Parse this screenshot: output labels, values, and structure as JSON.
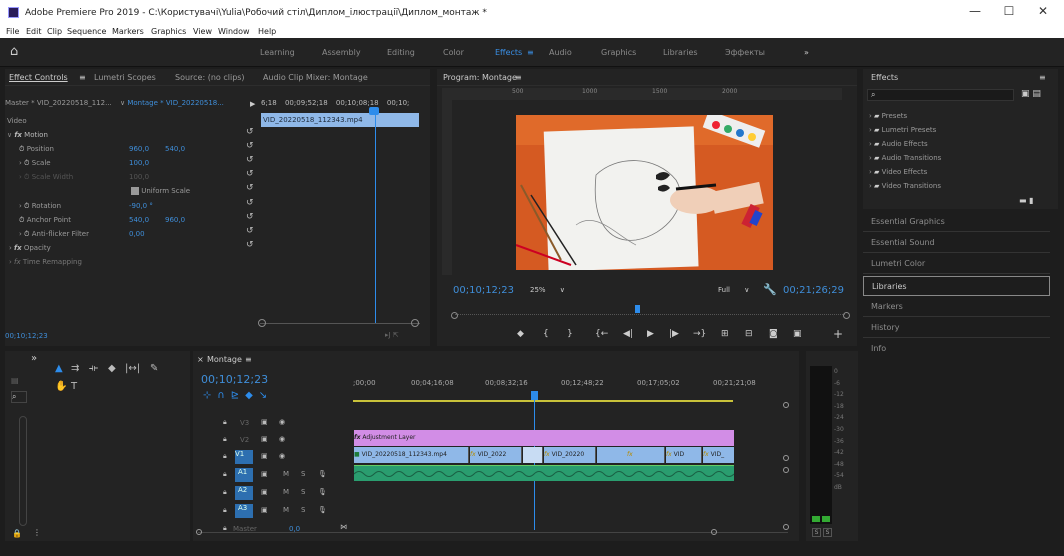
{
  "window": {
    "title": "Adobe Premiere Pro 2019 - C:\\Користувачі\\Yulia\\Робочий стіл\\Диплом_ілюстрації\\Диплом_монтаж *",
    "minimize": "—",
    "maximize": "☐",
    "close": "✕"
  },
  "menu": [
    "File",
    "Edit",
    "Clip",
    "Sequence",
    "Markers",
    "Graphics",
    "View",
    "Window",
    "Help"
  ],
  "workspaces": [
    "Learning",
    "Assembly",
    "Editing",
    "Color",
    "Effects",
    "Audio",
    "Graphics",
    "Libraries",
    "Эффекты",
    "»"
  ],
  "active_workspace": "Effects",
  "effect_controls": {
    "tabs": [
      "Effect Controls",
      "Lumetri Scopes",
      "Source: (no clips)",
      "Audio Clip Mixer: Montage"
    ],
    "source": "Master * VID_20220518_112...",
    "sequence": "Montage * VID_20220518...",
    "ruler": [
      "6;18",
      "00;09;52;18",
      "00;10;08;18",
      "00;10;"
    ],
    "clip_name": "VID_20220518_112343.mp4",
    "section": "Video",
    "rows": [
      {
        "label": "Motion",
        "v1": "",
        "v2": ""
      },
      {
        "label": "Position",
        "v1": "960,0",
        "v2": "540,0"
      },
      {
        "label": "Scale",
        "v1": "100,0",
        "v2": ""
      },
      {
        "label": "Scale Width",
        "v1": "100,0",
        "v2": ""
      },
      {
        "label": "Uniform Scale",
        "v1": "",
        "v2": ""
      },
      {
        "label": "Rotation",
        "v1": "-90,0 °",
        "v2": ""
      },
      {
        "label": "Anchor Point",
        "v1": "540,0",
        "v2": "960,0"
      },
      {
        "label": "Anti-flicker Filter",
        "v1": "0,00",
        "v2": ""
      },
      {
        "label": "Opacity",
        "v1": "",
        "v2": ""
      },
      {
        "label": "Time Remapping",
        "v1": "",
        "v2": ""
      }
    ],
    "timecode": "00;10;12;23"
  },
  "program": {
    "tab": "Program: Montage",
    "ruler": [
      "500",
      "1000",
      "1500",
      "2000"
    ],
    "timecode": "00;10;12;23",
    "zoom": "25%",
    "quality": "Full",
    "duration": "00;21;26;29"
  },
  "effects_panel": {
    "title": "Effects",
    "search_placeholder": "",
    "folders": [
      "Presets",
      "Lumetri Presets",
      "Audio Effects",
      "Audio Transitions",
      "Video Effects",
      "Video Transitions"
    ],
    "panels": [
      "Essential Graphics",
      "Essential Sound",
      "Lumetri Color",
      "Libraries",
      "Markers",
      "History",
      "Info"
    ],
    "active_panel": "Libraries"
  },
  "timeline": {
    "tab": "Montage",
    "timecode": "00;10;12;23",
    "ruler": [
      ";00;00",
      "00;04;16;08",
      "00;08;32;16",
      "00;12;48;22",
      "00;17;05;02",
      "00;21;21;08"
    ],
    "tracks": [
      {
        "name": "V3",
        "m": "",
        "s": ""
      },
      {
        "name": "V2",
        "m": "",
        "s": ""
      },
      {
        "name": "V1",
        "m": "",
        "s": ""
      },
      {
        "name": "A1",
        "m": "M",
        "s": "S"
      },
      {
        "name": "A2",
        "m": "M",
        "s": "S"
      },
      {
        "name": "A3",
        "m": "M",
        "s": "S"
      }
    ],
    "master": "Master",
    "master_value": "0,0",
    "adjustment_layer": "Adjustment Layer",
    "v1_clips": [
      "VID_20220518_112343.mp4",
      "VID_2022",
      "VID_20220",
      "VID",
      "VID_"
    ],
    "meter_labels": [
      "0",
      "-6",
      "-12",
      "-18",
      "-24",
      "-30",
      "-36",
      "-42",
      "-48",
      "-54",
      "dB"
    ],
    "meter_solo": [
      "S",
      "S"
    ]
  },
  "colors": {
    "accent": "#2d8ceb",
    "adjust": "#d28de6",
    "v1": "#8fb8e8",
    "audio": "#2a9d6f"
  }
}
